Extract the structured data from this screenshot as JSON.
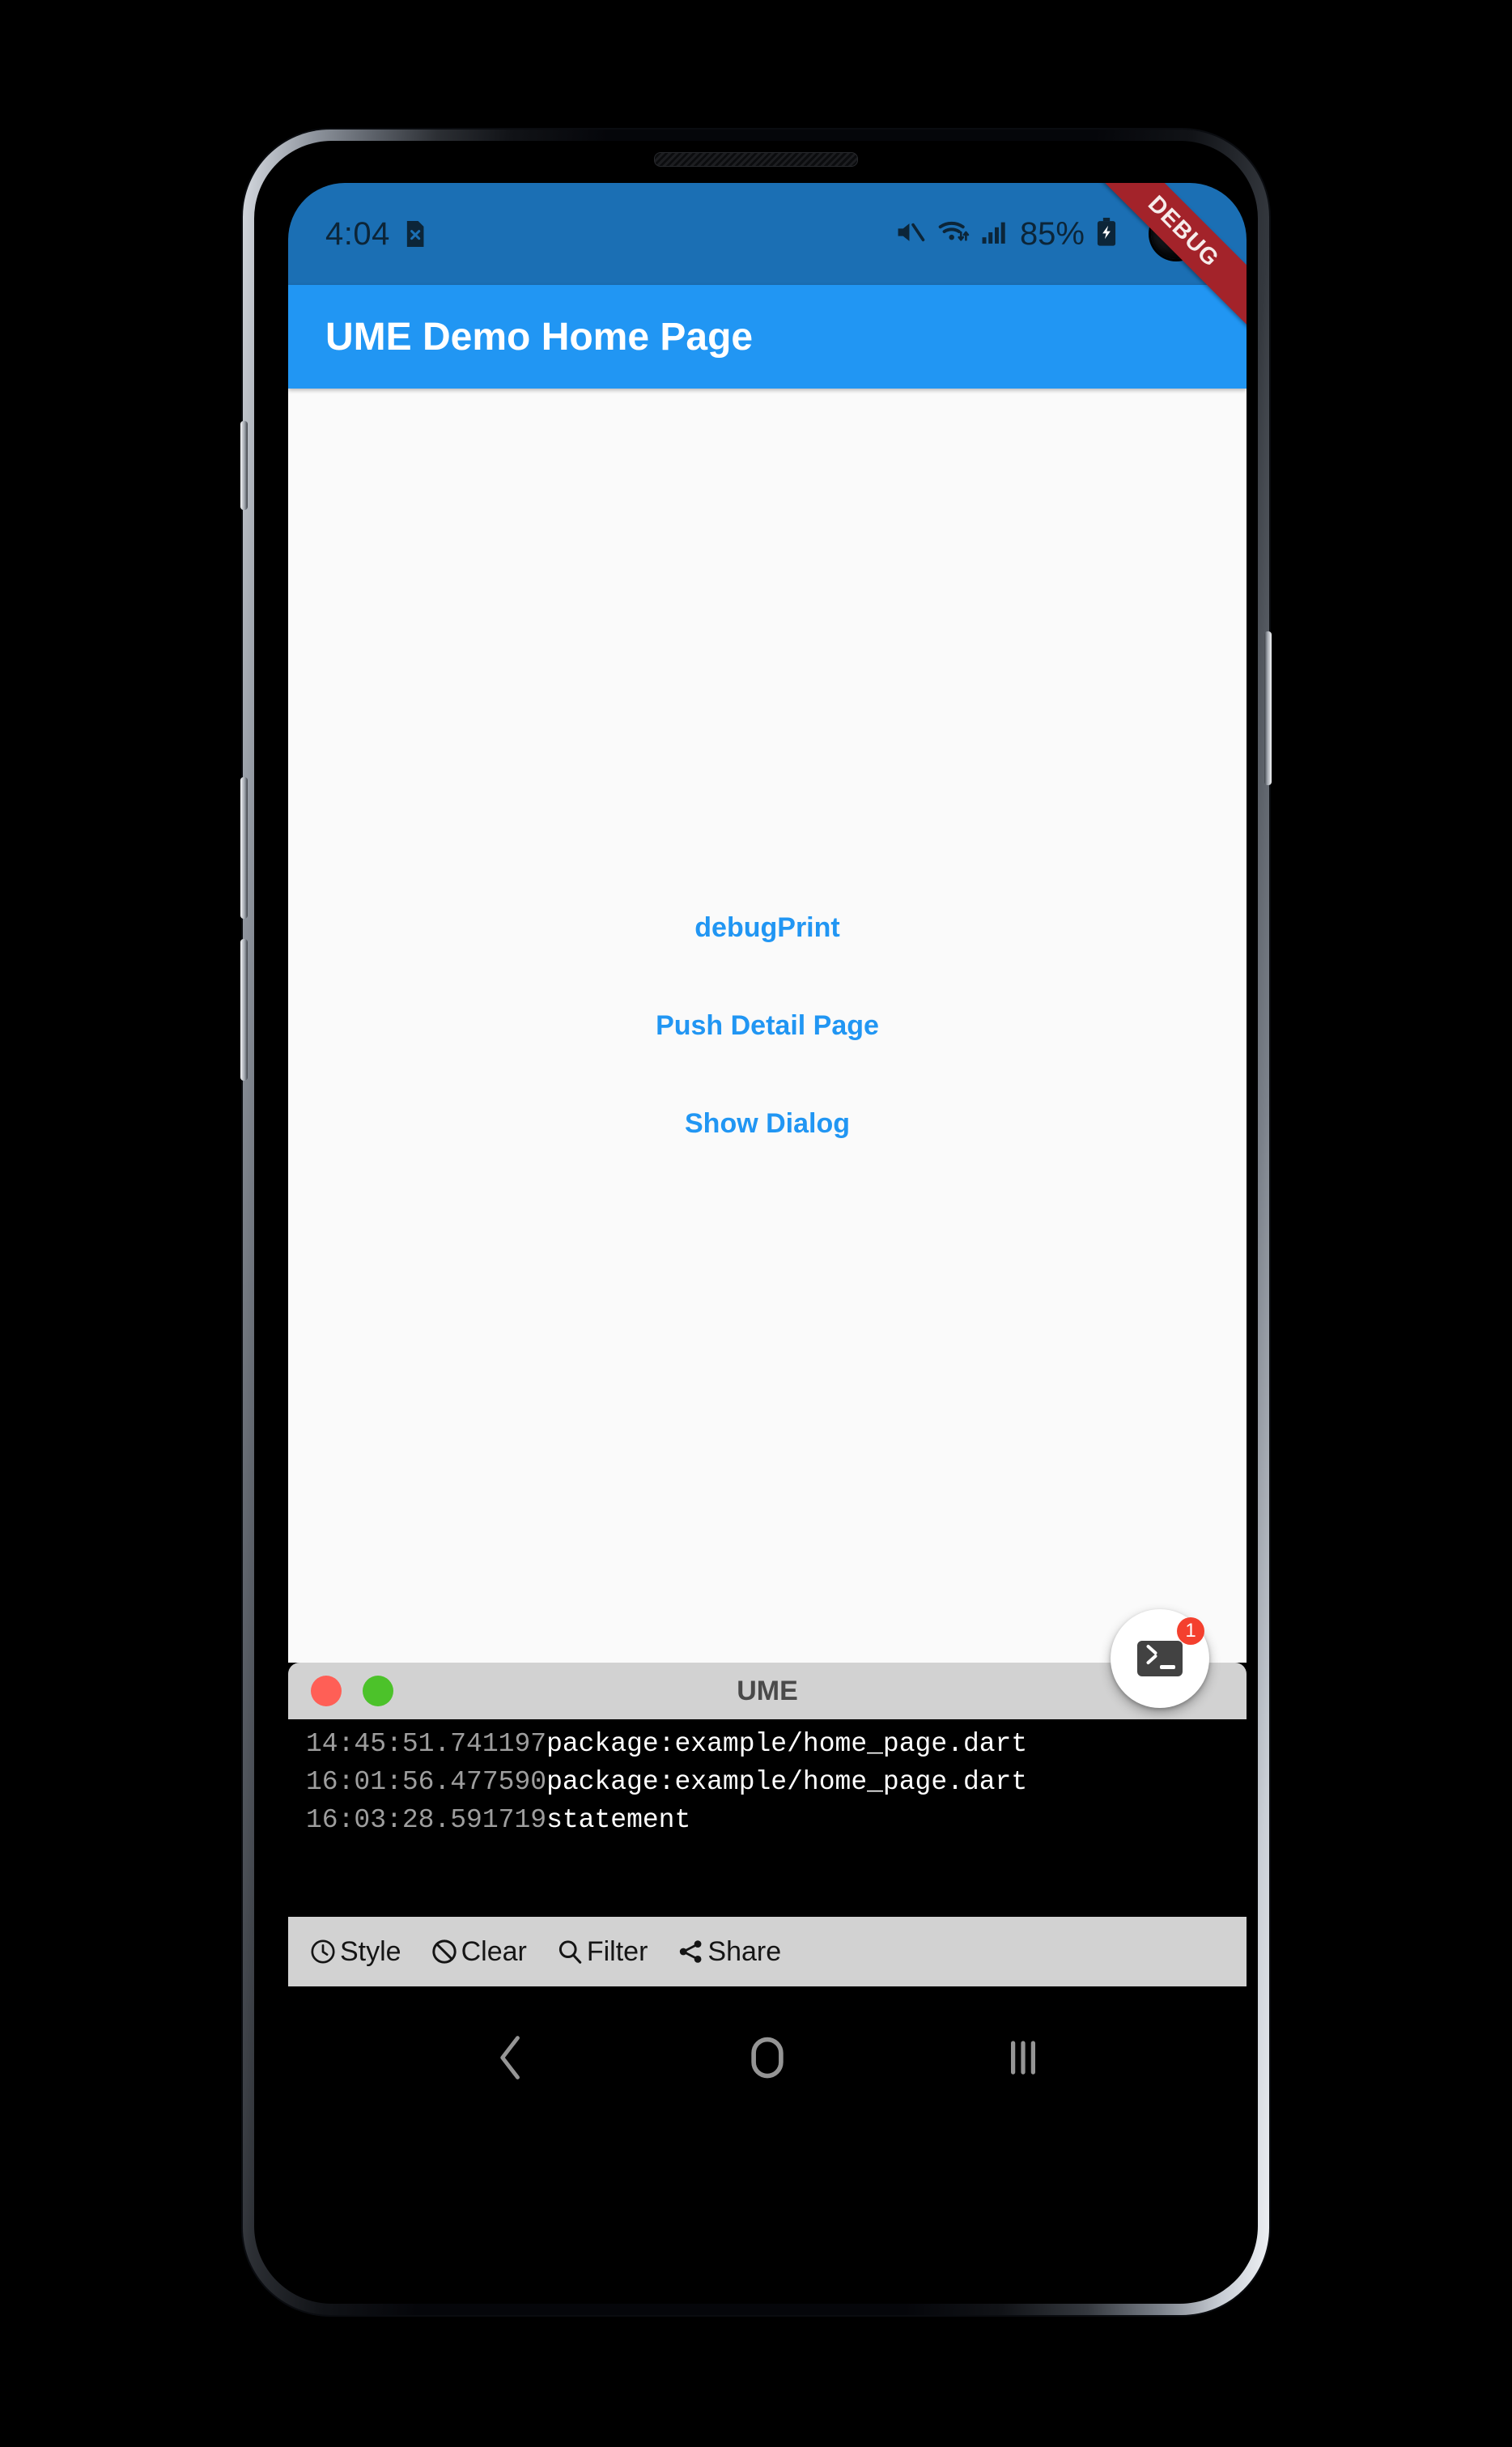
{
  "status_bar": {
    "clock": "4:04",
    "battery_percent": "85%",
    "icons": [
      "sim-off-icon",
      "volume-mute-icon",
      "wifi-icon",
      "cellular-signal-icon",
      "battery-charging-icon"
    ]
  },
  "debug_banner": {
    "label": "DEBUG"
  },
  "app_bar": {
    "title": "UME Demo Home Page"
  },
  "body": {
    "buttons": [
      {
        "label": "debugPrint",
        "name": "debug-print-button"
      },
      {
        "label": "Push Detail Page",
        "name": "push-detail-page-button"
      },
      {
        "label": "Show Dialog",
        "name": "show-dialog-button"
      }
    ]
  },
  "fab": {
    "icon": "terminal-icon",
    "badge_count": "1"
  },
  "console": {
    "title": "UME",
    "window_controls": [
      {
        "name": "close-dot",
        "color": "#ff5f56"
      },
      {
        "name": "expand-dot",
        "color": "#4cc22a"
      }
    ],
    "logs": [
      {
        "time": "14:45:51.741197",
        "message": "package:example/home_page.dart"
      },
      {
        "time": "16:01:56.477590",
        "message": "package:example/home_page.dart"
      },
      {
        "time": "16:03:28.591719",
        "message": "statement"
      }
    ],
    "toolbar": [
      {
        "label": "Style",
        "icon": "clock-icon"
      },
      {
        "label": "Clear",
        "icon": "block-icon"
      },
      {
        "label": "Filter",
        "icon": "search-icon"
      },
      {
        "label": "Share",
        "icon": "share-icon"
      }
    ]
  },
  "android_nav": {
    "back": "back-chevron-icon",
    "home": "home-circle-icon",
    "recents": "recents-bars-icon"
  },
  "colors": {
    "status_bar_bg": "#1b6fb4",
    "app_bar_bg": "#2196f3",
    "accent": "#2196f3",
    "body_bg": "#fafafa",
    "console_chrome": "#d2d2d2",
    "console_bg": "#000000",
    "badge": "#f4402e",
    "debug_ribbon": "#a3232a"
  }
}
